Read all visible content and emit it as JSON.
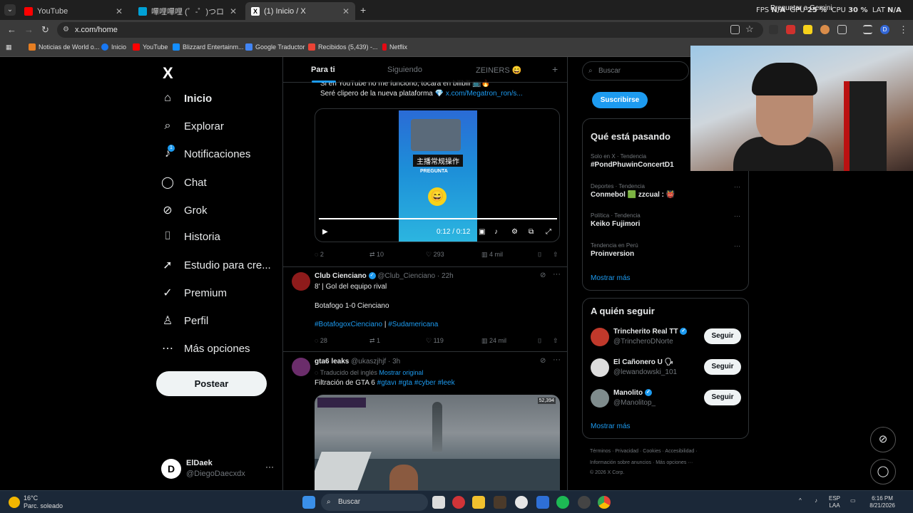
{
  "browser": {
    "tabs": [
      {
        "title": "YouTube",
        "color": "#ff0000"
      },
      {
        "title": "嗶哩嗶哩 (゜-゜)つロ 干杯~-bilibili",
        "color": "#00a1d6"
      },
      {
        "title": "(1) Inicio / X",
        "color": "#000000"
      }
    ],
    "perf": {
      "fps_label": "FPS",
      "fps": "N/A",
      "gpu_label": "GPU",
      "gpu": "25 %",
      "cpu_label": "CPU",
      "cpu": "30 %",
      "lat_label": "LAT",
      "lat": "N/A"
    },
    "gemini_label": "Preguntar a Gemini",
    "url": "x.com/home",
    "bookmarks": [
      {
        "label": "Noticias de World o...",
        "color": "#e67e22"
      },
      {
        "label": "Inicio",
        "color": "#1877f2"
      },
      {
        "label": "YouTube",
        "color": "#ff0000"
      },
      {
        "label": "Blizzard Entertainm...",
        "color": "#148eff"
      },
      {
        "label": "Google Traductor",
        "color": "#4285f4"
      },
      {
        "label": "Recibidos (5,439) -...",
        "color": "#ea4335"
      },
      {
        "label": "Netflix",
        "color": "#e50914"
      }
    ]
  },
  "sidebar": {
    "logo": "X",
    "items": [
      {
        "label": "Inicio",
        "icon": "home-icon",
        "glyph": "⌂"
      },
      {
        "label": "Explorar",
        "icon": "search-icon",
        "glyph": "⌕"
      },
      {
        "label": "Notificaciones",
        "icon": "bell-icon",
        "glyph": "♫"
      },
      {
        "label": "Chat",
        "icon": "chat-icon",
        "glyph": "◯"
      },
      {
        "label": "Grok",
        "icon": "grok-icon",
        "glyph": "⊘"
      },
      {
        "label": "Historia",
        "icon": "bookmark-icon",
        "glyph": "⌷"
      },
      {
        "label": "Estudio para cre...",
        "icon": "rocket-icon",
        "glyph": "➚"
      },
      {
        "label": "Premium",
        "icon": "verified-icon",
        "glyph": "✓"
      },
      {
        "label": "Perfil",
        "icon": "person-icon",
        "glyph": "♙"
      },
      {
        "label": "Más opciones",
        "icon": "more-icon",
        "glyph": "⋯"
      }
    ],
    "notif_badge": "1",
    "post_button": "Postear",
    "account": {
      "name": "ElDaek",
      "handle": "@DiegoDaecxdx",
      "avatar_letter": "D"
    }
  },
  "feed": {
    "tabs": [
      "Para ti",
      "Siguiendo",
      "ZEINERS 😄"
    ],
    "tab_plus": "+",
    "tweet1": {
      "line1": "Si en YouTube no me funciono, tocara en bilibili 📺🔥",
      "line2_prefix": "Seré clipero de la nueva plataforma 💎 ",
      "line2_link": "x.com/Megatron_ron/s...",
      "video_caption": "主播常规操作",
      "video_sub": "PREGUNTA",
      "video_time": "0:12 / 0:12",
      "progress": 1.0,
      "replies": "2",
      "retweets": "10",
      "likes": "293",
      "views": "4 mil"
    },
    "tweet2": {
      "name": "Club Cienciano",
      "handle": "@Club_Cienciano",
      "time": "22h",
      "line1": "8' | Gol del equipo rival",
      "line2": "Botafogo 1-0 Cienciano",
      "hashtag1": "#BotafogoxCienciano",
      "sep": " | ",
      "hashtag2": "#Sudamericana",
      "replies": "28",
      "retweets": "1",
      "likes": "119",
      "views": "24 mil"
    },
    "tweet3": {
      "name": "gta6 leaks",
      "handle": "@ukaszjhjf",
      "time": "3h",
      "translated": "Traducido del inglés",
      "show_original": "Mostrar original",
      "text": "Filtración de GTA 6 ",
      "tags": "#gtavı #gta #cyber #leek",
      "img_count": "52,394"
    }
  },
  "right": {
    "search_placeholder": "Buscar",
    "subscribe": "Suscribirse",
    "trending_title": "Qué está pasando",
    "trends": [
      {
        "meta": "Solo en X · Tendencia",
        "title": "#PondPhuwinConcertD1"
      },
      {
        "meta": "Deportes · Tendencia",
        "title": "Conmebol 🟩 zzcual : 👹"
      },
      {
        "meta": "Política · Tendencia",
        "title": "Keiko Fujimori"
      },
      {
        "meta": "Tendencia en Perú",
        "title": "Proinversion"
      }
    ],
    "trend_more": "Mostrar más",
    "who_title": "A quién seguir",
    "follow": [
      {
        "name": "Trincherito Real TT",
        "handle": "@TrincheroDNorte",
        "color": "#c0392b"
      },
      {
        "name": "El Cañonero U 🗣",
        "handle": "@lewandowski_101",
        "color": "#dddddd"
      },
      {
        "name": "Manolito",
        "handle": "@Manolitop_",
        "color": "#7f8c8d"
      }
    ],
    "follow_button": "Seguir",
    "follow_more": "Mostrar más",
    "footer1": "Términos   ·   Privacidad   ·   Cookies   ·   Accesibilidad   ·",
    "footer2": "Información sobre anuncios   ·   Más opciones ···",
    "footer3": "© 2026 X Corp."
  },
  "taskbar": {
    "temp": "16°C",
    "weather": "Parc. soleado",
    "search": "Buscar",
    "lang1": "ESP",
    "lang2": "LAA",
    "time": "6:16 PM",
    "date": "8/21/2026"
  }
}
